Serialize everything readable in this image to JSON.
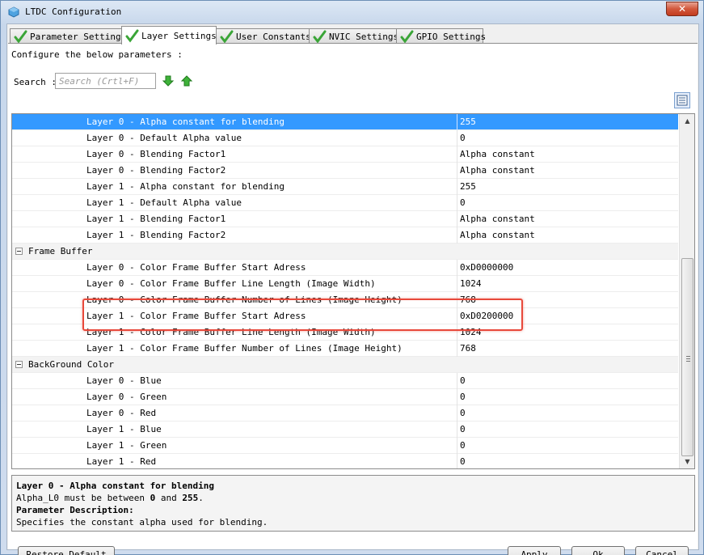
{
  "window": {
    "title": "LTDC Configuration",
    "close_label": "✕"
  },
  "tabs": [
    {
      "label": "Parameter Settings",
      "active": false
    },
    {
      "label": "Layer Settings",
      "active": true
    },
    {
      "label": "User Constants",
      "active": false
    },
    {
      "label": "NVIC Settings",
      "active": false
    },
    {
      "label": "GPIO Settings",
      "active": false
    }
  ],
  "configure_text": "Configure the below parameters :",
  "search": {
    "label": "Search :",
    "placeholder": "Search (Crtl+F)"
  },
  "rows": [
    {
      "type": "param",
      "name": "Layer 0 - Alpha constant for blending",
      "value": "255",
      "selected": true
    },
    {
      "type": "param",
      "name": "Layer 0 - Default Alpha value",
      "value": "0"
    },
    {
      "type": "param",
      "name": "Layer 0 - Blending Factor1",
      "value": "Alpha constant"
    },
    {
      "type": "param",
      "name": "Layer 0 - Blending Factor2",
      "value": "Alpha constant"
    },
    {
      "type": "param",
      "name": "Layer 1 - Alpha constant for blending",
      "value": "255"
    },
    {
      "type": "param",
      "name": "Layer 1 - Default Alpha value",
      "value": "0"
    },
    {
      "type": "param",
      "name": "Layer 1 - Blending Factor1",
      "value": "Alpha constant"
    },
    {
      "type": "param",
      "name": "Layer 1 - Blending Factor2",
      "value": "Alpha constant"
    },
    {
      "type": "group",
      "name": "Frame Buffer"
    },
    {
      "type": "param",
      "name": "Layer 0 - Color Frame Buffer Start Adress",
      "value": "0xD0000000"
    },
    {
      "type": "param",
      "name": "Layer 0 - Color Frame Buffer Line Length (Image Width)",
      "value": "1024"
    },
    {
      "type": "param",
      "name": "Layer 0 - Color Frame Buffer Number of Lines (Image Height)",
      "value": "768"
    },
    {
      "type": "param",
      "name": "Layer 1 - Color Frame Buffer Start Adress",
      "value": "0xD0200000"
    },
    {
      "type": "param",
      "name": "Layer 1 - Color Frame Buffer Line Length (Image Width)",
      "value": "1024"
    },
    {
      "type": "param",
      "name": "Layer 1 - Color Frame Buffer Number of Lines (Image Height)",
      "value": "768"
    },
    {
      "type": "group",
      "name": "BackGround Color"
    },
    {
      "type": "param",
      "name": "Layer 0 - Blue",
      "value": "0"
    },
    {
      "type": "param",
      "name": "Layer 0 - Green",
      "value": "0"
    },
    {
      "type": "param",
      "name": "Layer 0 - Red",
      "value": "0"
    },
    {
      "type": "param",
      "name": "Layer 1 - Blue",
      "value": "0"
    },
    {
      "type": "param",
      "name": "Layer 1 - Green",
      "value": "0"
    },
    {
      "type": "param",
      "name": "Layer 1 - Red",
      "value": "0"
    }
  ],
  "description": {
    "title": "Layer 0 - Alpha constant for blending",
    "line_prefix": "Alpha_L0 must be between ",
    "min": "0",
    "and": " and ",
    "max": "255",
    "line_suffix": ".",
    "heading": "Parameter Description:",
    "text": "Specifies the constant alpha used for blending."
  },
  "buttons": {
    "restore": "Restore Default",
    "apply": "Apply",
    "ok": "Ok",
    "cancel": "Cancel"
  },
  "colors": {
    "selection": "#3399ff",
    "highlight_box": "#e8493b",
    "check_green": "#3aa537"
  }
}
